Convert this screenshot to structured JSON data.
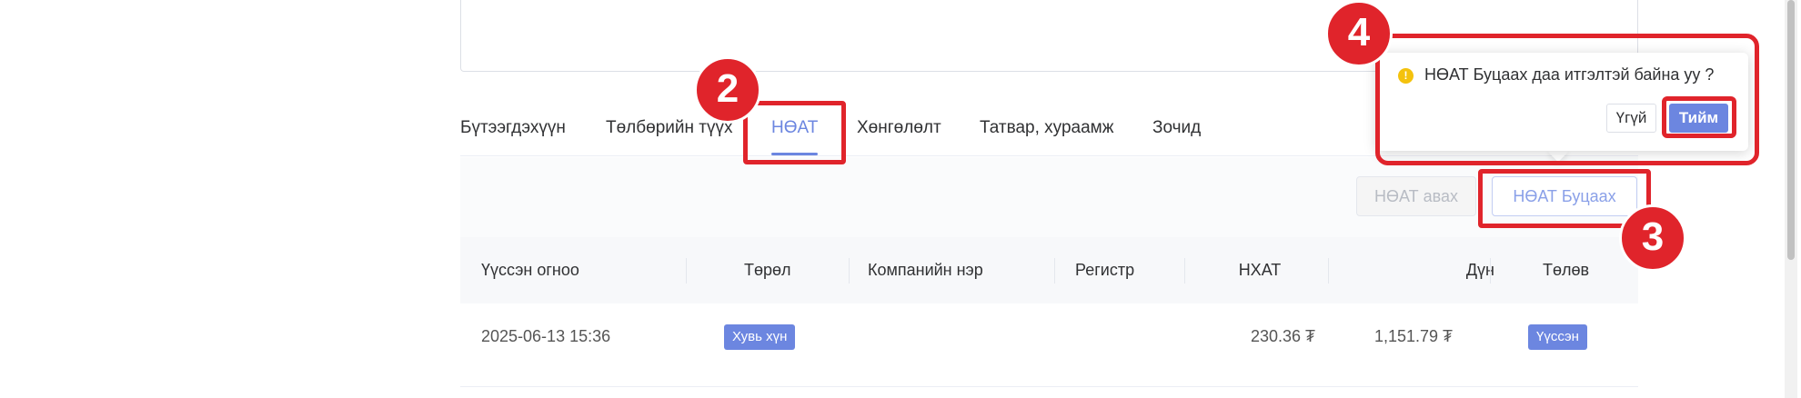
{
  "tabs": [
    {
      "label": "Бүтээгдэхүүн"
    },
    {
      "label": "Төлбөрийн түүх"
    },
    {
      "label": "НӨАТ"
    },
    {
      "label": "Хөнгөлөлт"
    },
    {
      "label": "Татвар, хураамж"
    },
    {
      "label": "Зочид"
    }
  ],
  "active_tab": "НӨАТ",
  "actions": {
    "get_vat": "НӨАТ авах",
    "return_vat": "НӨАТ Буцаах"
  },
  "table": {
    "columns": [
      "Үүссэн огноо",
      "Төрөл",
      "Компанийн нэр",
      "Регистр",
      "НХАТ",
      "Дүн",
      "Төлөв"
    ],
    "rows": [
      {
        "date": "2025-06-13 15:36",
        "type": "Хувь хүн",
        "company": "",
        "register": "",
        "nhat": "230.36 ₮",
        "amount": "1,151.79 ₮",
        "status": "Үүссэн"
      }
    ]
  },
  "popconfirm": {
    "icon": "warning-icon",
    "message": "НӨАТ Буцаах даа итгэлтэй байна уу ?",
    "cancel": "Үгүй",
    "confirm": "Тийм"
  },
  "annotations": {
    "b2": "2",
    "b3": "3",
    "b4": "4"
  },
  "colors": {
    "accent": "#6c86e0",
    "annotation": "#e0242b",
    "warning": "#f4c20d"
  }
}
